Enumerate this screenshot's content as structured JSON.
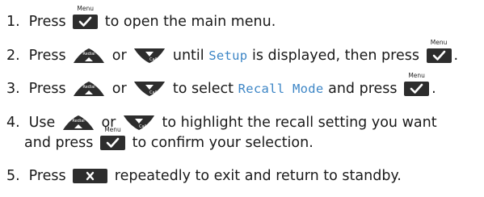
{
  "colors": {
    "button": "#2d2d2d",
    "check": "#ffffff",
    "lcd_text": "#3d86c6",
    "text": "#1a1a1a"
  },
  "icons": {
    "ok": "menu-ok-check-icon",
    "up": "redial-up-icon",
    "down": "calls-down-icon",
    "end": "end-x-icon"
  },
  "button_labels": {
    "menu": "Menu",
    "redial": "Redial",
    "calls": "Calls"
  },
  "steps": [
    {
      "num": "1.",
      "t1": "Press",
      "t2": "to open the main menu."
    },
    {
      "num": "2.",
      "t1": "Press",
      "t2": "or",
      "t3": "until",
      "lcd": "Setup",
      "t4": "is displayed, then press",
      "t5": "."
    },
    {
      "num": "3.",
      "t1": "Press",
      "t2": "or",
      "t3": "to select",
      "lcd": "Recall Mode",
      "t4": "and press",
      "t5": "."
    },
    {
      "num": "4.",
      "t1": "Use",
      "t2": "or",
      "t3": "to highlight the recall setting you want",
      "t4": "and press",
      "t5": "to confirm your selection."
    },
    {
      "num": "5.",
      "t1": "Press",
      "t2": "repeatedly to exit and return to standby."
    }
  ]
}
